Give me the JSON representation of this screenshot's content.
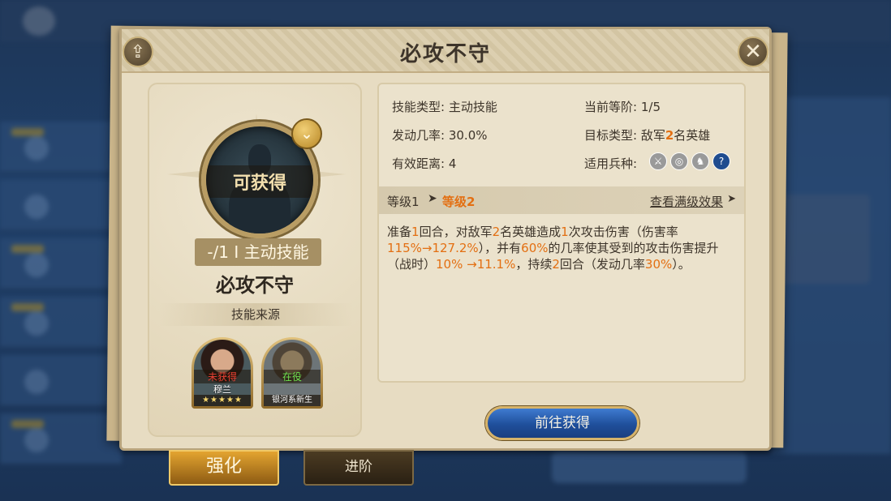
{
  "dialog": {
    "title": "必攻不守",
    "share_icon": "share-icon",
    "close_icon": "close-icon",
    "close_glyph": "✕"
  },
  "portrait": {
    "status_label": "可获得",
    "badge_icon": "chevron-down-icon"
  },
  "skill": {
    "tag": "-/1 I 主动技能",
    "name": "必攻不守",
    "source_label": "技能来源"
  },
  "heroes": [
    {
      "status": "未获得",
      "name": "穆兰",
      "sub": "★★★★★",
      "status_color": "#e94032"
    },
    {
      "status": "在役",
      "name": "",
      "sub": "银河系新生",
      "status_color": "#6ee24f"
    }
  ],
  "attributes": {
    "type_label": "技能类型:",
    "type_value": "主动技能",
    "rank_label": "当前等阶:",
    "rank_value": "1/5",
    "rate_label": "发动几率:",
    "rate_value": "30.0%",
    "target_label": "目标类型:",
    "target_prefix": "敌军",
    "target_count": "2",
    "target_suffix": "名英雄",
    "range_label": "有效距离:",
    "range_value": "4",
    "troop_label": "适用兵种:",
    "troop_icons": [
      "sword-icon",
      "target-icon",
      "horse-icon",
      "question-icon"
    ]
  },
  "level": {
    "from": "等级1",
    "arrow": "➤",
    "to": "等级2",
    "max_link": "查看满级效果",
    "max_arrow": "➤"
  },
  "description": {
    "p1": "准备",
    "n1": "1",
    "p2": "回合，对敌军",
    "n2": "2",
    "p3": "名英雄造成",
    "n3": "1",
    "p4": "次攻击伤害（伤害率",
    "n4": "115%→127.2%",
    "p5": "），并有",
    "n5": "60%",
    "p6": "的几率使其受到的攻击伤害提升（战时）",
    "n6": "10% →11.1%",
    "p7": "，持续",
    "n7": "2",
    "p8": "回合（发动几率",
    "n8": "30%",
    "p9": "）。"
  },
  "actions": {
    "go_button": "前往获得"
  },
  "tabs": {
    "enhance": "强化",
    "advance": "进阶"
  },
  "colors": {
    "highlight": "#e36f12",
    "panel_bg": "#e7dcc2",
    "button_blue": "#1f4f9b",
    "tab_gold": "#e3a430"
  }
}
